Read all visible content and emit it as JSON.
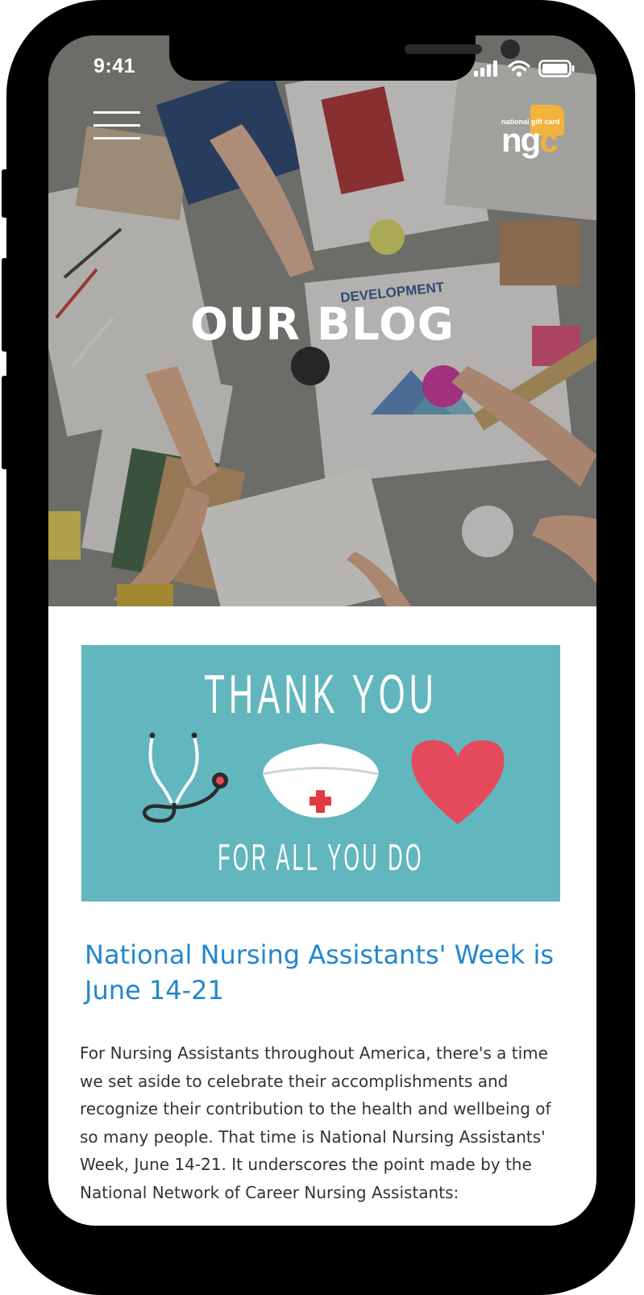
{
  "status_bar": {
    "time": "9:41"
  },
  "header": {
    "menu_icon": "hamburger-menu-icon",
    "logo_tagline": "national gift card",
    "logo_mark_ng": "ng",
    "logo_mark_c": "c"
  },
  "hero": {
    "title": "OUR BLOG",
    "photo_label": "DEVELOPMENT"
  },
  "banner": {
    "top_text": "THANK YOU",
    "bottom_text": "FOR ALL YOU DO",
    "icons": [
      "stethoscope-icon",
      "nurse-cap-icon",
      "heart-icon"
    ]
  },
  "post": {
    "title": "National Nursing Assistants' Week is June 14-21",
    "body": "For Nursing Assistants throughout America, there's a time we set aside to celebrate their accomplishments and recognize their contribution to the health and wellbeing of so many people. That time is National Nursing Assistants' Week, June 14-21.  It underscores the point made by the National Network of Career Nursing Assistants:"
  },
  "colors": {
    "accent_blue": "#2387cc",
    "banner_teal": "#62b6be",
    "brand_gold": "#f2b33c",
    "heart_red": "#e44a5b"
  }
}
